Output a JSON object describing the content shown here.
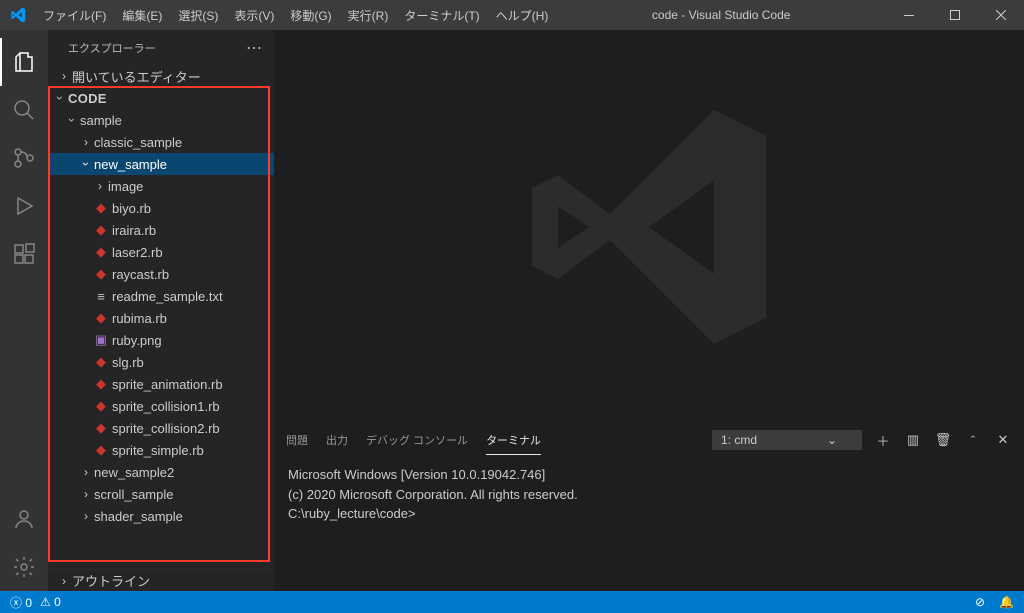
{
  "titlebar": {
    "menus": [
      "ファイル(F)",
      "編集(E)",
      "選択(S)",
      "表示(V)",
      "移動(G)",
      "実行(R)",
      "ターミナル(T)",
      "ヘルプ(H)"
    ],
    "title": "code - Visual Studio Code"
  },
  "sidebar": {
    "header": "エクスプローラー",
    "open_editors": "開いているエディター",
    "root": "CODE",
    "outline": "アウトライン",
    "tree": {
      "sample": "sample",
      "classic_sample": "classic_sample",
      "new_sample": "new_sample",
      "image": "image",
      "files": [
        "biyo.rb",
        "iraira.rb",
        "laser2.rb",
        "raycast.rb",
        "readme_sample.txt",
        "rubima.rb",
        "ruby.png",
        "slg.rb",
        "sprite_animation.rb",
        "sprite_collision1.rb",
        "sprite_collision2.rb",
        "sprite_simple.rb"
      ],
      "new_sample2": "new_sample2",
      "scroll_sample": "scroll_sample",
      "shader_sample": "shader_sample"
    }
  },
  "panel": {
    "tabs": {
      "problems": "問題",
      "output": "出力",
      "debug": "デバッグ コンソール",
      "terminal": "ターミナル"
    },
    "term_selector": "1: cmd",
    "terminal_lines": [
      "Microsoft Windows [Version 10.0.19042.746]",
      "(c) 2020 Microsoft Corporation. All rights reserved.",
      "",
      "C:\\ruby_lecture\\code>"
    ]
  },
  "statusbar": {
    "errors": "0",
    "warnings": "0"
  }
}
